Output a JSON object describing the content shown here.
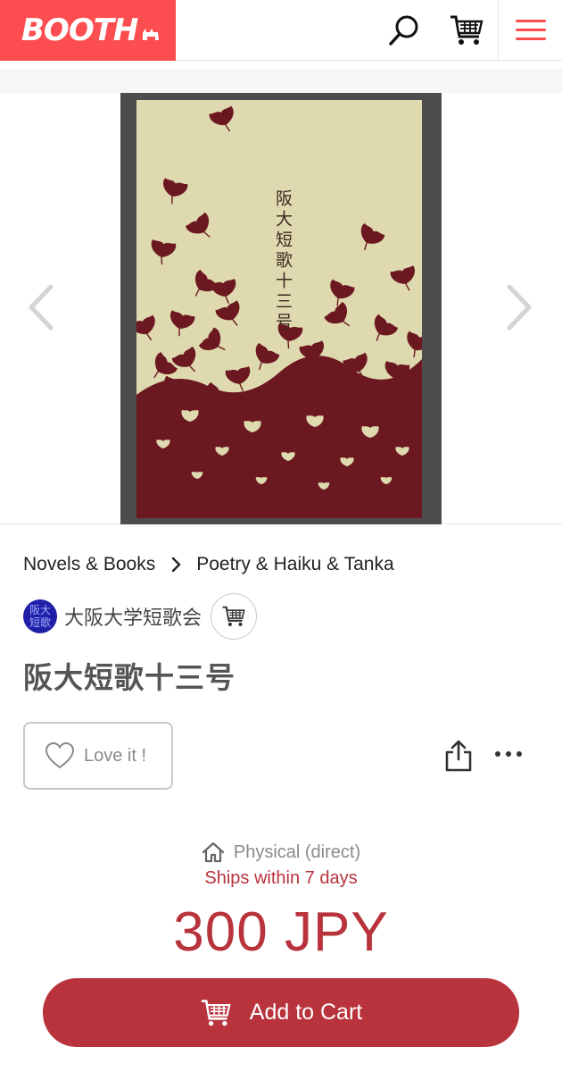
{
  "header": {
    "logo_text": "BOOTH",
    "brand_color": "#fc4d50",
    "icons": [
      "search-icon",
      "cart-icon",
      "menu-icon"
    ]
  },
  "gallery": {
    "cover_title": "阪大短歌十三号",
    "prev_icon": "chevron-left-icon",
    "next_icon": "chevron-right-icon"
  },
  "breadcrumb": {
    "items": [
      "Novels & Books",
      "Poetry & Haiku & Tanka"
    ]
  },
  "shop": {
    "avatar_text": "阪大短歌",
    "name": "大阪大学短歌会"
  },
  "item": {
    "title": "阪大短歌十三号"
  },
  "actions": {
    "love_label": "Love it !"
  },
  "shipping": {
    "type": "Physical (direct)",
    "time": "Ships within 7 days"
  },
  "price": "300 JPY",
  "cart": {
    "label": "Add to Cart"
  },
  "colors": {
    "accent": "#b8333c",
    "cover_background": "#dfd9af",
    "leaf": "#6b1820"
  }
}
